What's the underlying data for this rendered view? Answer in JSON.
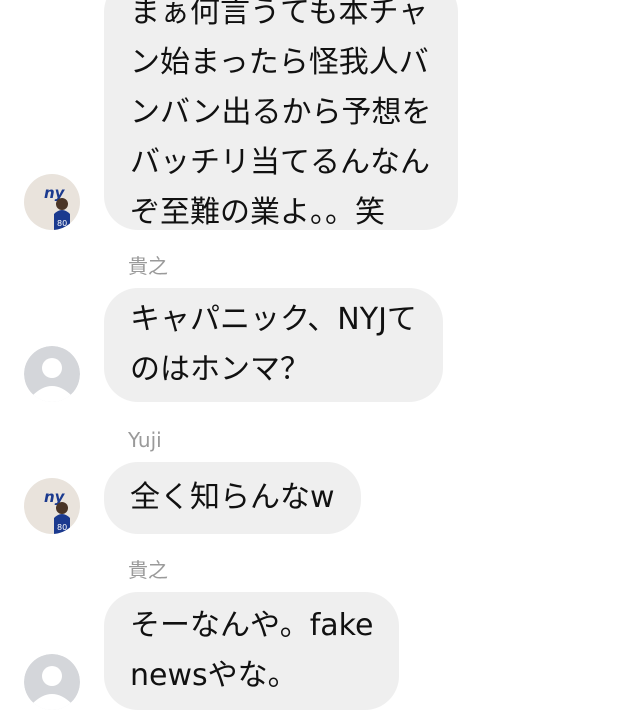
{
  "colors": {
    "bubble_bg": "#efefef",
    "sender_name": "#9a9a9a",
    "text": "#111111",
    "default_avatar_bg": "#d4d6da",
    "giants_blue": "#1b3a8f",
    "giants_red": "#c8102e"
  },
  "messages": [
    {
      "sender": "",
      "avatar": "ny-giants-avatar",
      "lines": [
        "まぁ何言うても本チャ",
        "ン始まったら怪我人バ",
        "ンバン出るから予想を",
        "バッチリ当てるんなん",
        "ぞ至難の業よ。。笑"
      ]
    },
    {
      "sender": "貴之",
      "avatar": "default-person-avatar",
      "lines": [
        "キャパニック、NYJて",
        "のはホンマ？"
      ]
    },
    {
      "sender": "Yuji",
      "avatar": "ny-giants-avatar",
      "lines": [
        "全く知らんなw"
      ]
    },
    {
      "sender": "貴之",
      "avatar": "default-person-avatar",
      "lines": [
        "そーなんや。fake",
        "newsやな。"
      ]
    }
  ]
}
